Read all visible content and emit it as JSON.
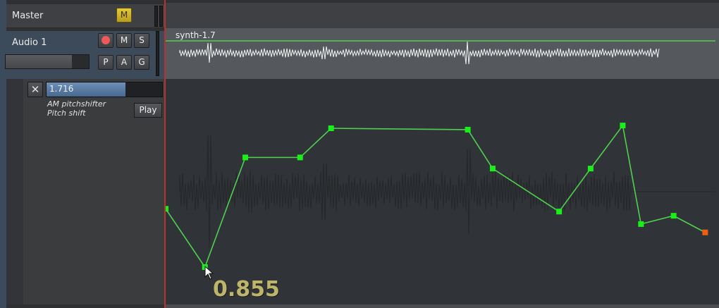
{
  "tracks": {
    "master": {
      "name": "Master",
      "m_label": "M"
    },
    "audio1": {
      "name": "Audio 1",
      "m_label": "M",
      "s_label": "S",
      "p_label": "P",
      "a_label": "A",
      "g_label": "G"
    }
  },
  "automation": {
    "value_text": "1.716",
    "value_fraction": 0.68,
    "plugin": "AM pitchshifter",
    "parameter": "Pitch shift",
    "play_label": "Play",
    "hover_value": "0.855"
  },
  "region": {
    "name": "synth-1.7"
  },
  "colors": {
    "automation_line": "#4fd14f",
    "control_point": "#19ef19",
    "selected_point": "#f05d11",
    "playhead": "#b8332f",
    "readout": "#bdb56a"
  },
  "icons": [
    "record-icon",
    "close-icon",
    "mouse-pointer-icon"
  ],
  "automation_points": [
    {
      "t": 0.0,
      "v": 0.42
    },
    {
      "t": 0.071,
      "v": 0.0
    },
    {
      "t": 0.144,
      "v": 0.79
    },
    {
      "t": 0.243,
      "v": 0.79
    },
    {
      "t": 0.299,
      "v": 1.0
    },
    {
      "t": 0.546,
      "v": 0.99
    },
    {
      "t": 0.591,
      "v": 0.71
    },
    {
      "t": 0.711,
      "v": 0.4
    },
    {
      "t": 0.768,
      "v": 0.71
    },
    {
      "t": 0.826,
      "v": 1.02
    },
    {
      "t": 0.859,
      "v": 0.31
    },
    {
      "t": 0.918,
      "v": 0.37
    },
    {
      "t": 0.975,
      "v": 0.25,
      "selected": true
    }
  ]
}
